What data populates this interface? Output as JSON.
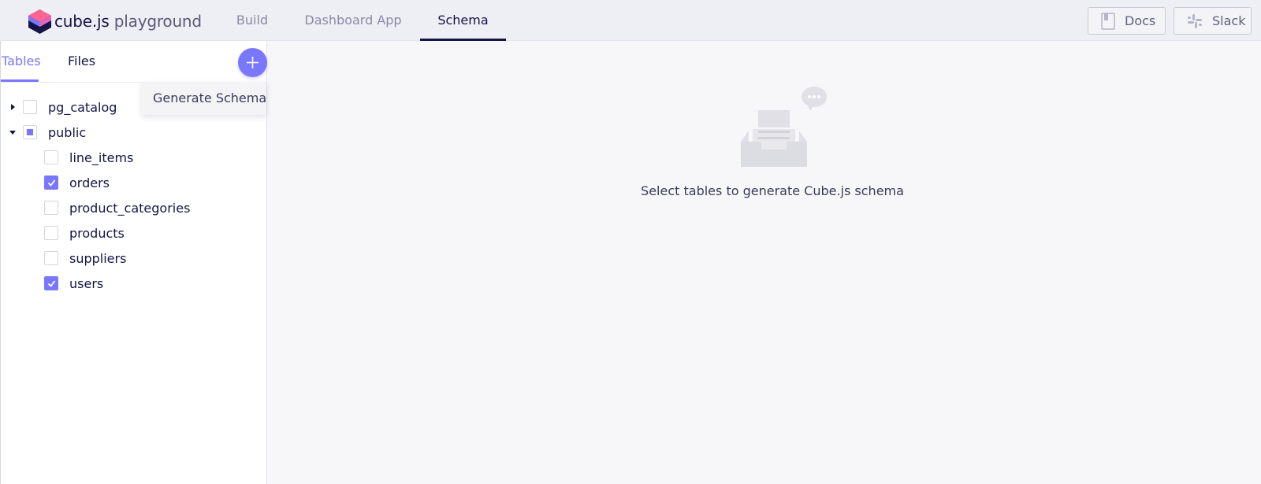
{
  "header": {
    "logo_word": "cube.js",
    "logo_suffix": "playground",
    "nav": [
      {
        "label": "Build",
        "active": false
      },
      {
        "label": "Dashboard App",
        "active": false
      },
      {
        "label": "Schema",
        "active": true
      }
    ],
    "docs_label": "Docs",
    "slack_label": "Slack"
  },
  "sidebar": {
    "tabs": [
      {
        "label": "Tables",
        "active": true
      },
      {
        "label": "Files",
        "active": false
      }
    ],
    "dropdown_item": "Generate Schema",
    "tree": {
      "schemas": [
        {
          "name": "pg_catalog",
          "expanded": false,
          "state": "unchecked"
        },
        {
          "name": "public",
          "expanded": true,
          "state": "partial",
          "tables": [
            {
              "name": "line_items",
              "checked": false
            },
            {
              "name": "orders",
              "checked": true
            },
            {
              "name": "product_categories",
              "checked": false
            },
            {
              "name": "products",
              "checked": false
            },
            {
              "name": "suppliers",
              "checked": false
            },
            {
              "name": "users",
              "checked": true
            }
          ]
        }
      ]
    }
  },
  "main": {
    "empty_message": "Select tables to generate Cube.js schema"
  },
  "colors": {
    "accent": "#7a77ff",
    "text_dark": "#141446",
    "text_muted": "#8a8aa4",
    "header_bg": "#eeeef5",
    "main_bg": "#f7f7fa"
  },
  "icons": {
    "logo": "cube-logo-icon",
    "docs": "book-icon",
    "slack": "slack-icon",
    "add": "plus-icon",
    "expand": "caret-right-icon",
    "collapse": "caret-down-icon",
    "check": "check-icon",
    "empty": "empty-inbox-icon"
  }
}
